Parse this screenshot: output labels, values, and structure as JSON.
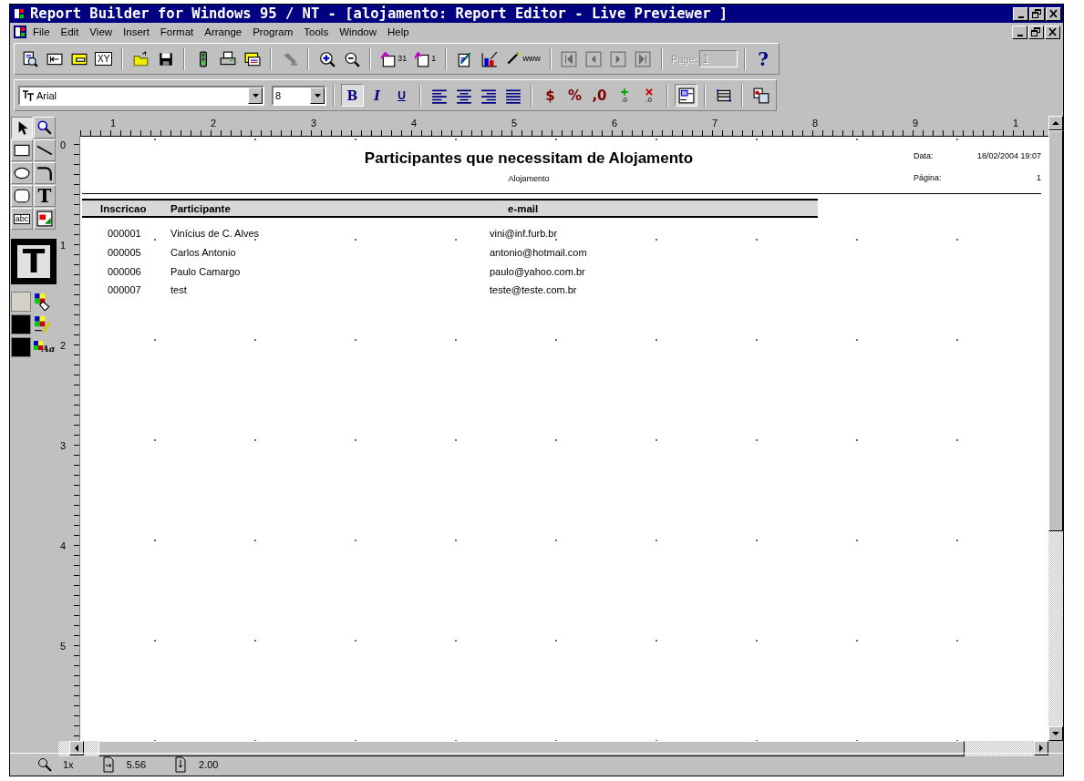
{
  "window": {
    "title": "Report Builder for Windows 95 / NT - [alojamento: Report Editor - Live Previewer ]"
  },
  "menu": [
    {
      "label": "File"
    },
    {
      "label": "Edit"
    },
    {
      "label": "View"
    },
    {
      "label": "Insert"
    },
    {
      "label": "Format"
    },
    {
      "label": "Arrange"
    },
    {
      "label": "Program"
    },
    {
      "label": "Tools"
    },
    {
      "label": "Window"
    },
    {
      "label": "Help"
    }
  ],
  "toolbar": {
    "groups": [
      [
        {
          "disabled": false
        },
        {
          "disabled": false
        },
        {
          "disabled": false
        },
        {
          "disabled": false,
          "label": "XY"
        }
      ],
      [
        {
          "disabled": false
        },
        {
          "disabled": false
        }
      ],
      [
        {
          "disabled": false
        },
        {
          "disabled": false
        },
        {
          "disabled": false
        }
      ],
      [
        {
          "disabled": true
        }
      ],
      [
        {
          "disabled": false
        },
        {
          "disabled": false
        }
      ],
      [
        {
          "disabled": false,
          "label": "31"
        },
        {
          "disabled": false,
          "label": "1"
        }
      ],
      [
        {
          "disabled": false
        },
        {
          "disabled": false
        },
        {
          "disabled": false,
          "label": "www"
        }
      ],
      [
        {
          "disabled": true
        },
        {
          "disabled": true
        },
        {
          "disabled": true
        },
        {
          "disabled": true
        }
      ]
    ],
    "page_label": {
      "text": "Page:",
      "disabled": true
    },
    "page_field": {
      "value": "1",
      "disabled": true
    },
    "help": {
      "label": "?"
    }
  },
  "format_bar": {
    "font": {
      "value": "Arial"
    },
    "size": {
      "value": "8"
    },
    "style_buttons": [
      {
        "label": "B",
        "pressed": true
      },
      {
        "label": "I",
        "pressed": false
      },
      {
        "label": "U",
        "pressed": false
      }
    ],
    "align_buttons": [
      {
        "pressed": false
      },
      {
        "pressed": false
      },
      {
        "pressed": false
      },
      {
        "pressed": false
      }
    ],
    "number_buttons": [
      {
        "kind": "symbol",
        "label": "$"
      },
      {
        "kind": "symbol",
        "label": "%"
      },
      {
        "kind": "symbol",
        "label": ",0"
      },
      {
        "kind": "add",
        "label": ".0"
      },
      {
        "kind": "remove",
        "label": ".0"
      }
    ],
    "layout_buttons": [
      {
        "pressed": true
      },
      {
        "pressed": false
      },
      {
        "pressed": false
      }
    ]
  },
  "tool_palette": {
    "tools": [
      {
        "selected": true
      },
      {
        "selected": false
      },
      {
        "selected": false
      },
      {
        "selected": false
      },
      {
        "selected": false
      },
      {
        "selected": false
      },
      {
        "selected": false
      },
      {
        "selected": false,
        "label": "T"
      },
      {
        "selected": false,
        "label": "abc"
      },
      {
        "selected": false
      }
    ],
    "current_tool": {
      "label": "T"
    },
    "colors": [
      {
        "color": "#d4d0c8"
      },
      {
        "color": "#000000"
      },
      {
        "color": "#000000",
        "label": "Aa"
      }
    ]
  },
  "horizontal_ruler": {
    "labels": [
      "1",
      "2",
      "3",
      "4",
      "5",
      "6",
      "7",
      "8",
      "9",
      "1"
    ]
  },
  "vertical_ruler": {
    "labels": [
      "0",
      "1",
      "2",
      "3",
      "4",
      "5"
    ]
  },
  "report": {
    "title": "Participantes que necessitam de Alojamento",
    "subtitle": "Alojamento",
    "info": [
      {
        "label": "Data:",
        "value": "18/02/2004 19:07"
      },
      {
        "label": "Página:",
        "value": "1"
      }
    ],
    "columns": [
      "Inscricao",
      "Participante",
      "e-mail"
    ],
    "rows": [
      [
        "000001",
        "Vinícius de C. Alves",
        "vini@inf.furb.br"
      ],
      [
        "000005",
        "Carlos Antonio",
        "antonio@hotmail.com"
      ],
      [
        "000006",
        "Paulo Camargo",
        "paulo@yahoo.com.br"
      ],
      [
        "000007",
        "test",
        "teste@teste.com.br"
      ]
    ]
  },
  "status_bar": {
    "items": [
      {
        "text": "1x"
      },
      {
        "text": "5.56"
      },
      {
        "text": "2.00"
      }
    ]
  }
}
